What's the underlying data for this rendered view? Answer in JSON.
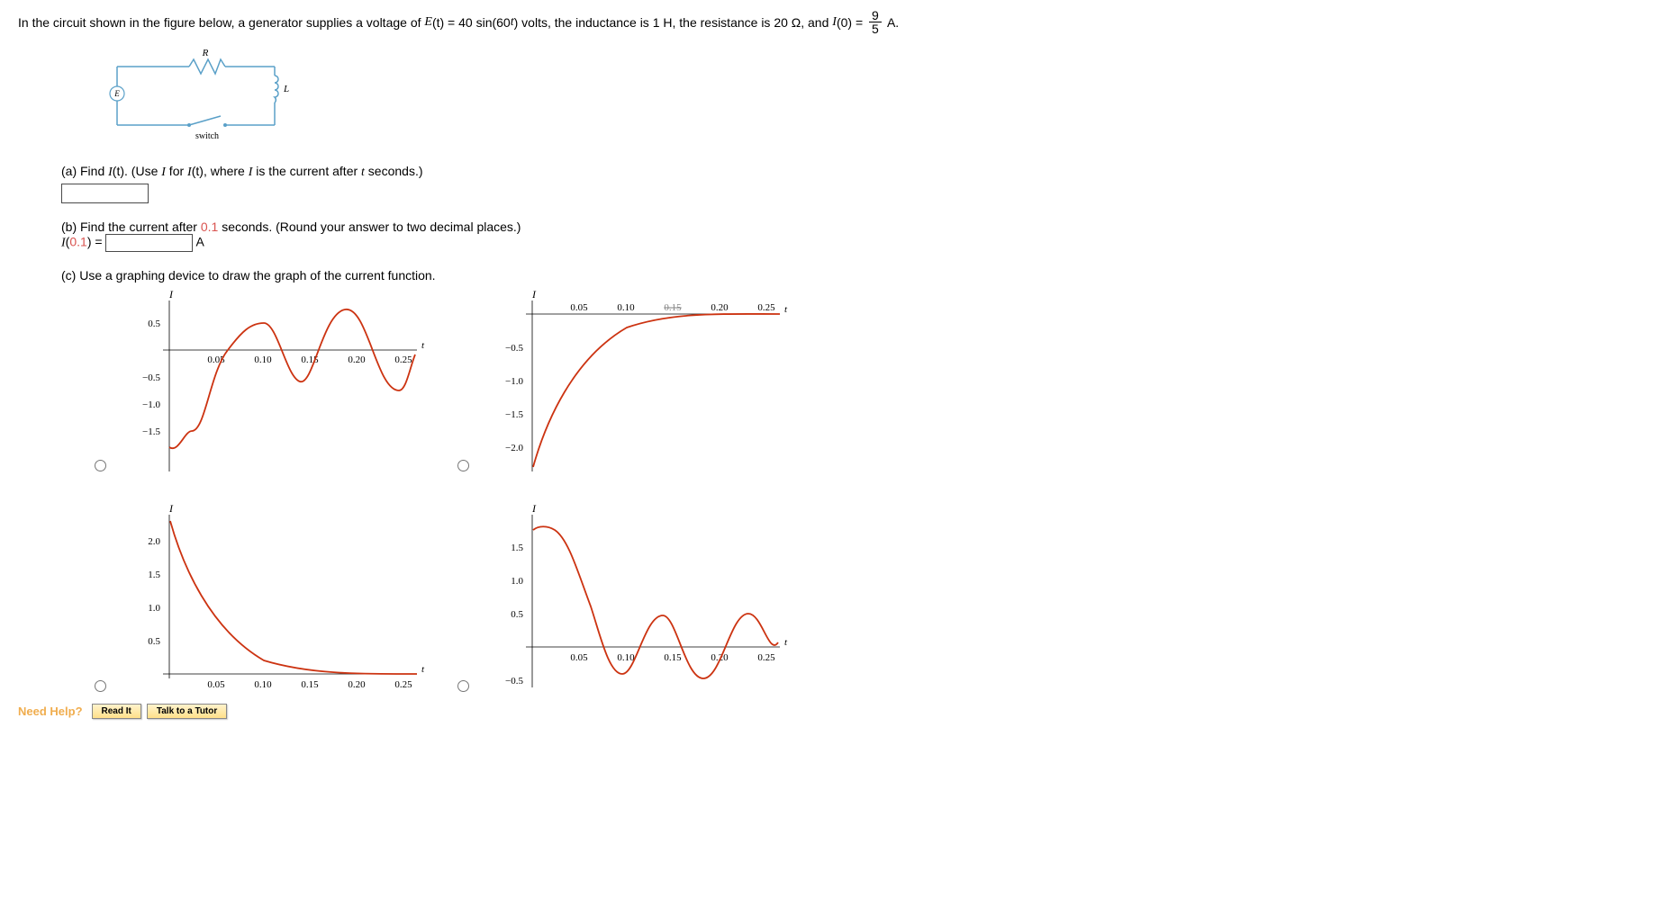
{
  "problem": {
    "pre": "In the circuit shown in the figure below, a generator supplies a voltage of ",
    "E_label": "E",
    "E_arg": "(t)",
    "eq": " = 40 sin(60",
    "t_var": "t",
    "post_eq": ") volts, the inductance is 1 H, the resistance is 20 Ω, and ",
    "I_label": "I",
    "I_arg": "(0) = ",
    "frac_num": "9",
    "frac_den": "5",
    "unit": " A."
  },
  "circuit": {
    "R": "R",
    "L": "L",
    "E": "E",
    "switch": "switch"
  },
  "partA": {
    "text1": "(a) Find ",
    "I_t": "I",
    "I_arg": "(t)",
    "text2": ". (Use ",
    "I2": "I",
    "text3": " for ",
    "I3": "I",
    "I3_arg": "(t)",
    "text4": ", where ",
    "I4": "I",
    "text5": " is the current after ",
    "t": "t",
    "text6": " seconds.)"
  },
  "partB": {
    "text1": "(b) Find the current after ",
    "val": "0.1",
    "text2": " seconds. (Round your answer to two decimal places.)",
    "line2a": "I",
    "line2b": "(",
    "line2c": "0.1",
    "line2d": ") = ",
    "unit": " A"
  },
  "partC": {
    "text": "(c) Use a graphing device to draw the graph of the current function."
  },
  "graph_ticks": {
    "y_axis_label": "I",
    "x_axis_label": "t",
    "x": [
      "0.05",
      "0.10",
      "0.15",
      "0.20",
      "0.25"
    ],
    "g1_y": [
      "0.5",
      "−0.5",
      "−1.0",
      "−1.5"
    ],
    "g2_y": [
      "−0.5",
      "−1.0",
      "−1.5",
      "−2.0"
    ],
    "g3_y": [
      "2.0",
      "1.5",
      "1.0",
      "0.5"
    ],
    "g4_y": [
      "1.5",
      "1.0",
      "0.5",
      "−0.5"
    ]
  },
  "help": {
    "label": "Need Help?",
    "read": "Read It",
    "tutor": "Talk to a Tutor"
  },
  "chart_data": [
    {
      "type": "line",
      "title": "Graph option 1",
      "xlabel": "t",
      "ylabel": "I",
      "xlim": [
        0,
        0.27
      ],
      "ylim": [
        -1.8,
        0.9
      ],
      "note": "oscillating curve starting near -1.8, amplitude growing, crossing zero around 0.05, 0.10, 0.15, 0.20, 0.25"
    },
    {
      "type": "line",
      "title": "Graph option 2",
      "xlabel": "t",
      "ylabel": "I",
      "xlim": [
        0,
        0.27
      ],
      "ylim": [
        -2.3,
        0.2
      ],
      "note": "monotone increasing from about -2.3 at t=0 toward 0, asymptotic"
    },
    {
      "type": "line",
      "title": "Graph option 3",
      "xlabel": "t",
      "ylabel": "I",
      "xlim": [
        0,
        0.27
      ],
      "ylim": [
        0,
        2.3
      ],
      "note": "monotone decreasing from about 2.3 at t=0 toward 0, asymptotic"
    },
    {
      "type": "line",
      "title": "Graph option 4",
      "xlabel": "t",
      "ylabel": "I",
      "xlim": [
        0,
        0.27
      ],
      "ylim": [
        -0.7,
        1.8
      ],
      "note": "starts near 1.8, rises, then damped oscillation around 0"
    }
  ]
}
